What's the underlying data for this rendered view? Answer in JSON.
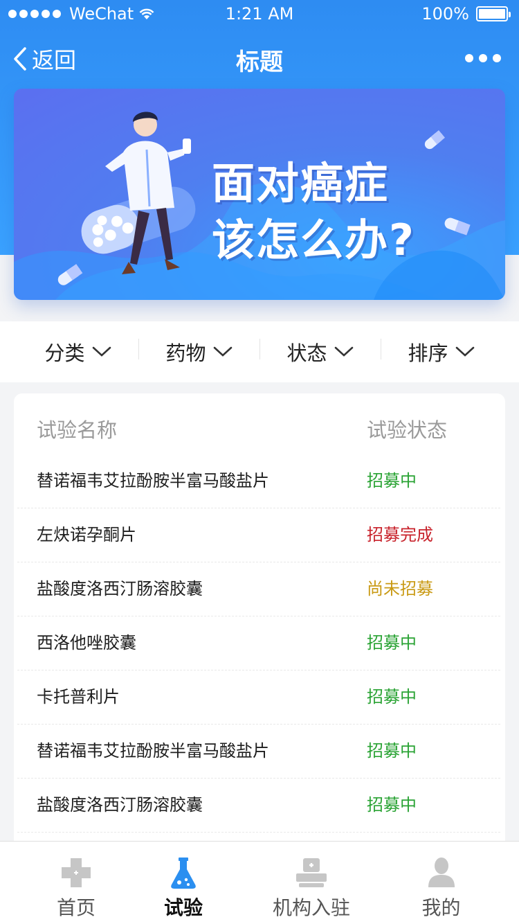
{
  "status_bar": {
    "carrier": "WeChat",
    "time": "1:21 AM",
    "battery": "100%"
  },
  "nav": {
    "back_label": "返回",
    "title": "标题"
  },
  "banner": {
    "line1": "面对癌症",
    "line2": "该怎么办?"
  },
  "filters": [
    {
      "label": "分类"
    },
    {
      "label": "药物"
    },
    {
      "label": "状态"
    },
    {
      "label": "排序"
    }
  ],
  "list": {
    "header_name": "试验名称",
    "header_status": "试验状态",
    "rows": [
      {
        "name": "替诺福韦艾拉酚胺半富马酸盐片",
        "status": "招募中",
        "status_color": "#2aa334"
      },
      {
        "name": "左炔诺孕酮片",
        "status": "招募完成",
        "status_color": "#c8232c"
      },
      {
        "name": "盐酸度洛西汀肠溶胶囊",
        "status": "尚未招募",
        "status_color": "#c99a14"
      },
      {
        "name": "西洛他唑胶囊",
        "status": "招募中",
        "status_color": "#2aa334"
      },
      {
        "name": "卡托普利片",
        "status": "招募中",
        "status_color": "#2aa334"
      },
      {
        "name": "替诺福韦艾拉酚胺半富马酸盐片",
        "status": "招募中",
        "status_color": "#2aa334"
      },
      {
        "name": "盐酸度洛西汀肠溶胶囊",
        "status": "招募中",
        "status_color": "#2aa334"
      }
    ]
  },
  "tabs": [
    {
      "label": "首页",
      "icon": "home-cross-icon"
    },
    {
      "label": "试验",
      "icon": "flask-icon",
      "active": true
    },
    {
      "label": "机构入驻",
      "icon": "hospital-icon"
    },
    {
      "label": "我的",
      "icon": "user-icon"
    }
  ],
  "colors": {
    "primary": "#2e8cf2",
    "recruiting": "#2aa334",
    "completed": "#c8232c",
    "not_started": "#c99a14"
  }
}
